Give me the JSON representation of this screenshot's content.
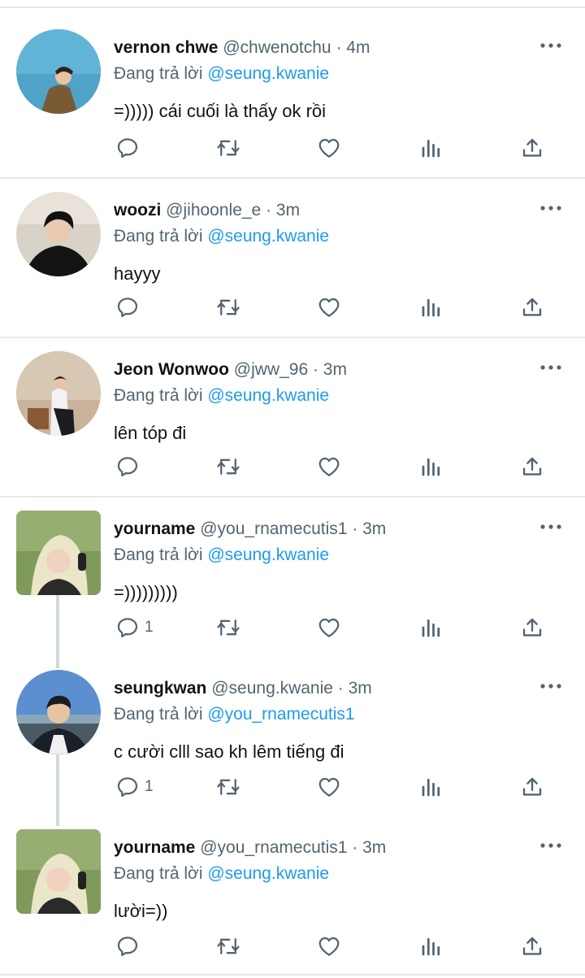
{
  "reply_prefix": "Đang trả lời",
  "tweets": [
    {
      "name": "vernon chwe",
      "meta": "@chwenotchu · 4m",
      "replying_to": "@seung.kwanie",
      "text": "=))))) cái cuối là thấy ok rồi",
      "reply_count": ""
    },
    {
      "name": "woozi",
      "meta": "@jihoonle_e · 3m",
      "replying_to": "@seung.kwanie",
      "text": "hayyy",
      "reply_count": ""
    },
    {
      "name": "Jeon Wonwoo",
      "meta": "@jww_96 · 3m",
      "replying_to": "@seung.kwanie",
      "text": "lên tóp đi",
      "reply_count": ""
    },
    {
      "name": "yourname",
      "meta": "@you_rnamecutis1 · 3m",
      "replying_to": "@seung.kwanie",
      "text": "=)))))))))",
      "reply_count": "1"
    },
    {
      "name": "seungkwan",
      "meta": "@seung.kwanie · 3m",
      "replying_to": "@you_rnamecutis1",
      "text": "c cười clll sao kh lêm tiếng đi",
      "reply_count": "1"
    },
    {
      "name": "yourname",
      "meta": "@you_rnamecutis1 · 3m",
      "replying_to": "@seung.kwanie",
      "text": "lười=))",
      "reply_count": ""
    }
  ],
  "icons": [
    "reply-icon",
    "retweet-icon",
    "like-icon",
    "analytics-icon",
    "share-icon",
    "more-icon"
  ],
  "colors": {
    "link": "#1d9bf0",
    "secondary_text": "#536471",
    "divider": "#e6e9ec"
  }
}
